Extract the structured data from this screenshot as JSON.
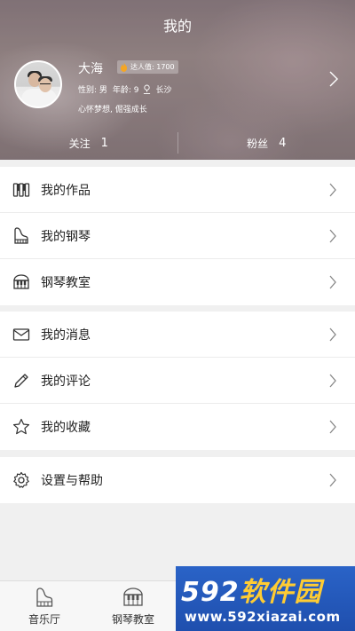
{
  "header": {
    "title": "我的",
    "user": {
      "name": "大海",
      "badge_label": "达人值: 1700",
      "gender_label": "性别: 男",
      "age_label": "年龄: 9",
      "city": "长沙",
      "signature": "心怀梦想, 倔强成长"
    },
    "stats": [
      {
        "label": "关注",
        "value": "1"
      },
      {
        "label": "粉丝",
        "value": "4"
      }
    ]
  },
  "menu": {
    "group1": [
      {
        "icon": "piano-keys-icon",
        "label": "我的作品"
      },
      {
        "icon": "grand-piano-icon",
        "label": "我的钢琴"
      },
      {
        "icon": "piano-classroom-icon",
        "label": "钢琴教室"
      }
    ],
    "group2": [
      {
        "icon": "envelope-icon",
        "label": "我的消息"
      },
      {
        "icon": "pencil-icon",
        "label": "我的评论"
      },
      {
        "icon": "star-icon",
        "label": "我的收藏"
      }
    ],
    "group3": [
      {
        "icon": "gear-icon",
        "label": "设置与帮助"
      }
    ]
  },
  "bottom_nav": [
    {
      "icon": "grand-piano-icon",
      "label": "音乐厅"
    },
    {
      "icon": "piano-classroom-icon",
      "label": "钢琴教室"
    }
  ],
  "watermark": {
    "number": "592",
    "text": "软件园",
    "url": "www.592xiazai.com"
  },
  "colors": {
    "badge_flame": "#f5a623",
    "watermark_bg": "#2a63c7",
    "watermark_accent": "#ffcc33"
  }
}
